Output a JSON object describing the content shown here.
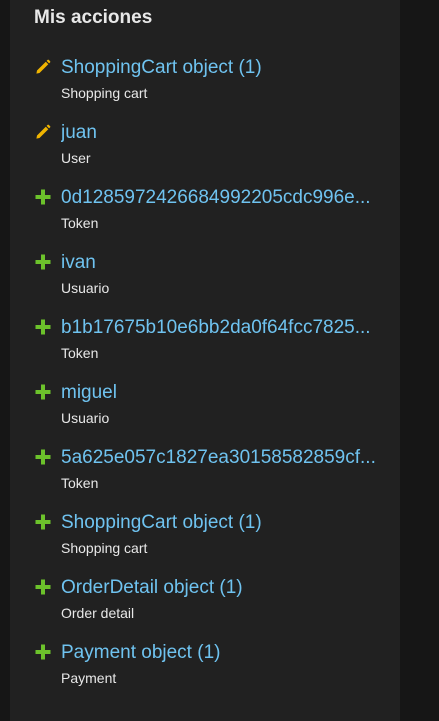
{
  "module": {
    "title": "Mis acciones"
  },
  "colors": {
    "panel_background": "#212121",
    "page_background": "#161616",
    "link": "#6fc3f0",
    "text": "#e8e8e8",
    "edit_icon": "#f0b400",
    "add_icon": "#6cc22b"
  },
  "actions": [
    {
      "icon": "pencil-icon",
      "label": "ShoppingCart object (1)",
      "type": "Shopping cart"
    },
    {
      "icon": "pencil-icon",
      "label": "juan",
      "type": "User"
    },
    {
      "icon": "plus-icon",
      "label": "0d1285972426684992205cdc996e...",
      "type": "Token"
    },
    {
      "icon": "plus-icon",
      "label": "ivan",
      "type": "Usuario"
    },
    {
      "icon": "plus-icon",
      "label": "b1b17675b10e6bb2da0f64fcc7825...",
      "type": "Token"
    },
    {
      "icon": "plus-icon",
      "label": "miguel",
      "type": "Usuario"
    },
    {
      "icon": "plus-icon",
      "label": "5a625e057c1827ea30158582859cf...",
      "type": "Token"
    },
    {
      "icon": "plus-icon",
      "label": "ShoppingCart object (1)",
      "type": "Shopping cart"
    },
    {
      "icon": "plus-icon",
      "label": "OrderDetail object (1)",
      "type": "Order detail"
    },
    {
      "icon": "plus-icon",
      "label": "Payment object (1)",
      "type": "Payment"
    }
  ]
}
